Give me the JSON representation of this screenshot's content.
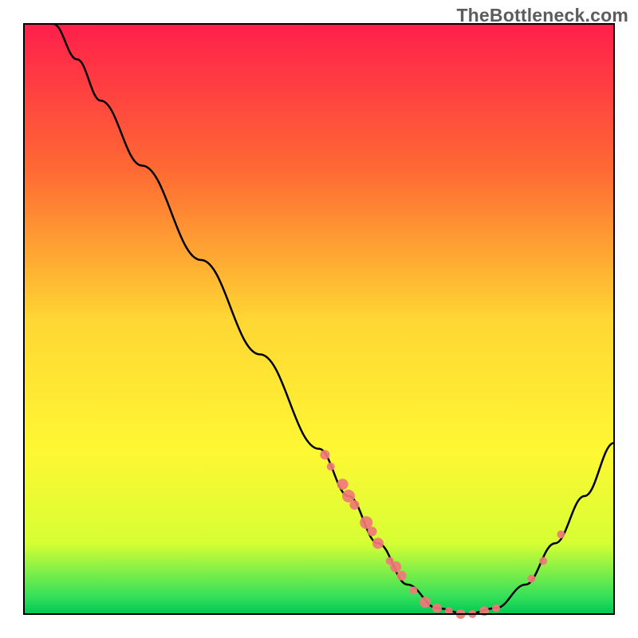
{
  "watermark": "TheBottleneck.com",
  "chart_data": {
    "type": "line",
    "title": "",
    "xlabel": "",
    "ylabel": "",
    "xlim": [
      0,
      100
    ],
    "ylim": [
      0,
      100
    ],
    "gradient_stops": [
      {
        "offset": 0,
        "color": "#ff1f4b"
      },
      {
        "offset": 25,
        "color": "#ff6a33"
      },
      {
        "offset": 50,
        "color": "#ffd633"
      },
      {
        "offset": 72,
        "color": "#fff733"
      },
      {
        "offset": 88,
        "color": "#d6ff33"
      },
      {
        "offset": 97,
        "color": "#35e05a"
      },
      {
        "offset": 100,
        "color": "#00c853"
      }
    ],
    "series": [
      {
        "name": "curve",
        "type": "line",
        "color": "#000000",
        "points": [
          {
            "x": 5,
            "y": 100
          },
          {
            "x": 9,
            "y": 94
          },
          {
            "x": 13,
            "y": 87
          },
          {
            "x": 20,
            "y": 76
          },
          {
            "x": 30,
            "y": 60
          },
          {
            "x": 40,
            "y": 44
          },
          {
            "x": 50,
            "y": 28
          },
          {
            "x": 55,
            "y": 20
          },
          {
            "x": 60,
            "y": 12
          },
          {
            "x": 65,
            "y": 5
          },
          {
            "x": 70,
            "y": 1
          },
          {
            "x": 75,
            "y": 0
          },
          {
            "x": 80,
            "y": 1
          },
          {
            "x": 85,
            "y": 5
          },
          {
            "x": 90,
            "y": 12
          },
          {
            "x": 95,
            "y": 20
          },
          {
            "x": 100,
            "y": 29
          }
        ]
      },
      {
        "name": "markers",
        "type": "scatter",
        "color": "#f07878",
        "points": [
          {
            "x": 51,
            "y": 27,
            "r": 6
          },
          {
            "x": 52,
            "y": 25,
            "r": 5
          },
          {
            "x": 54,
            "y": 22,
            "r": 7
          },
          {
            "x": 55,
            "y": 20,
            "r": 8
          },
          {
            "x": 56,
            "y": 18.5,
            "r": 6
          },
          {
            "x": 58,
            "y": 15.5,
            "r": 8
          },
          {
            "x": 59,
            "y": 14,
            "r": 6
          },
          {
            "x": 60,
            "y": 12,
            "r": 7
          },
          {
            "x": 62,
            "y": 9,
            "r": 5
          },
          {
            "x": 63,
            "y": 8,
            "r": 7
          },
          {
            "x": 64,
            "y": 6.5,
            "r": 6
          },
          {
            "x": 66,
            "y": 4,
            "r": 5
          },
          {
            "x": 68,
            "y": 2,
            "r": 7
          },
          {
            "x": 70,
            "y": 1,
            "r": 6
          },
          {
            "x": 72,
            "y": 0.5,
            "r": 5
          },
          {
            "x": 74,
            "y": 0,
            "r": 6
          },
          {
            "x": 76,
            "y": 0,
            "r": 5
          },
          {
            "x": 78,
            "y": 0.5,
            "r": 6
          },
          {
            "x": 80,
            "y": 1,
            "r": 5
          },
          {
            "x": 86,
            "y": 6,
            "r": 5
          },
          {
            "x": 88,
            "y": 9,
            "r": 5
          },
          {
            "x": 91,
            "y": 13.5,
            "r": 5
          }
        ]
      }
    ]
  }
}
